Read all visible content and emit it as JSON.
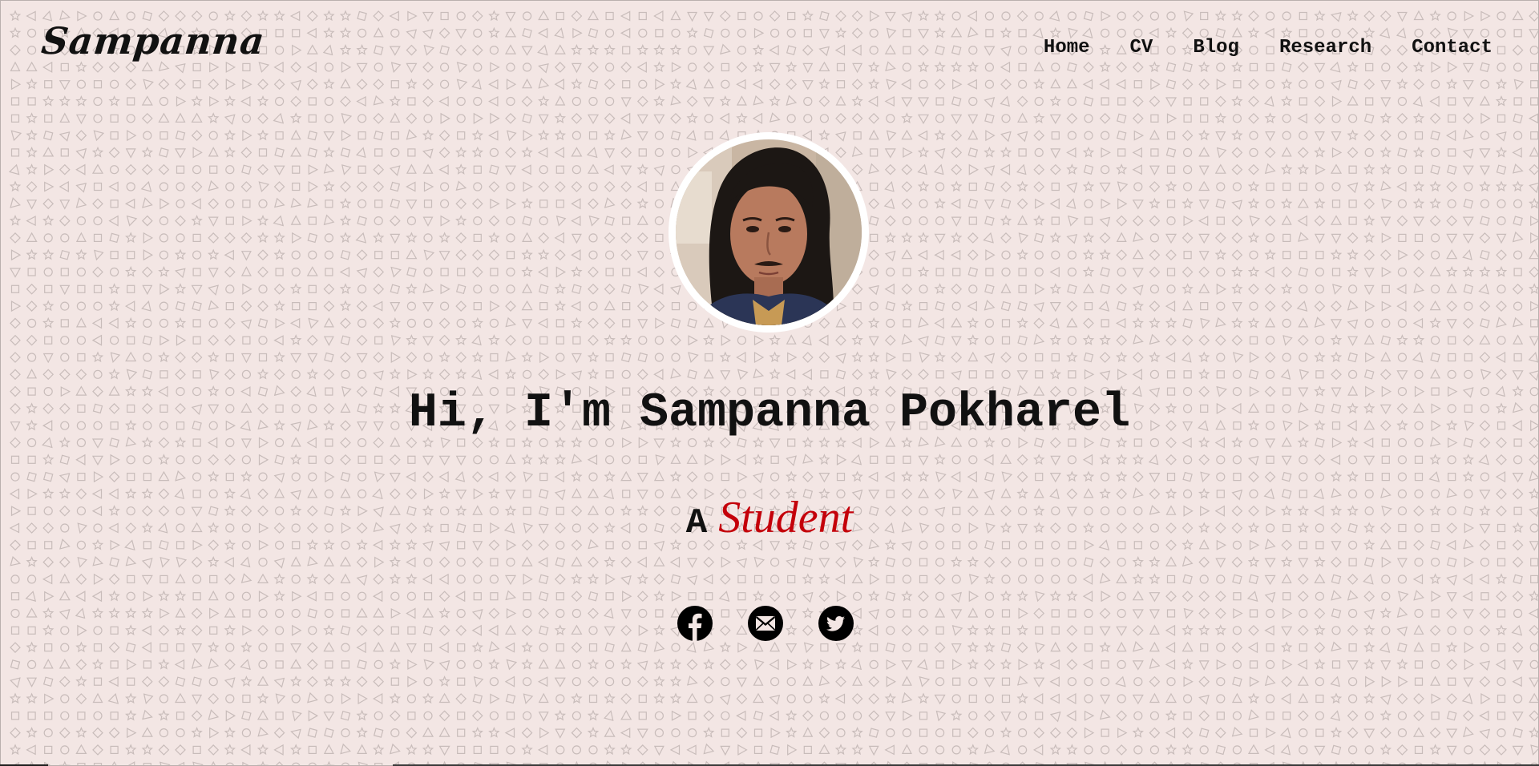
{
  "brand": {
    "logo_text": "Sampanna"
  },
  "nav": {
    "items": [
      {
        "label": "Home"
      },
      {
        "label": "CV"
      },
      {
        "label": "Blog"
      },
      {
        "label": "Research"
      },
      {
        "label": "Contact"
      }
    ]
  },
  "hero": {
    "title": "Hi, I'm Sampanna Pokharel",
    "tagline_prefix": "A",
    "tagline_role": "Student"
  },
  "socials": [
    {
      "icon": "facebook-icon"
    },
    {
      "icon": "email-icon"
    },
    {
      "icon": "twitter-icon"
    }
  ],
  "colors": {
    "background": "#f3e6e4",
    "pattern_stroke": "#c8bcba",
    "accent": "#c4000a",
    "text": "#111111"
  }
}
